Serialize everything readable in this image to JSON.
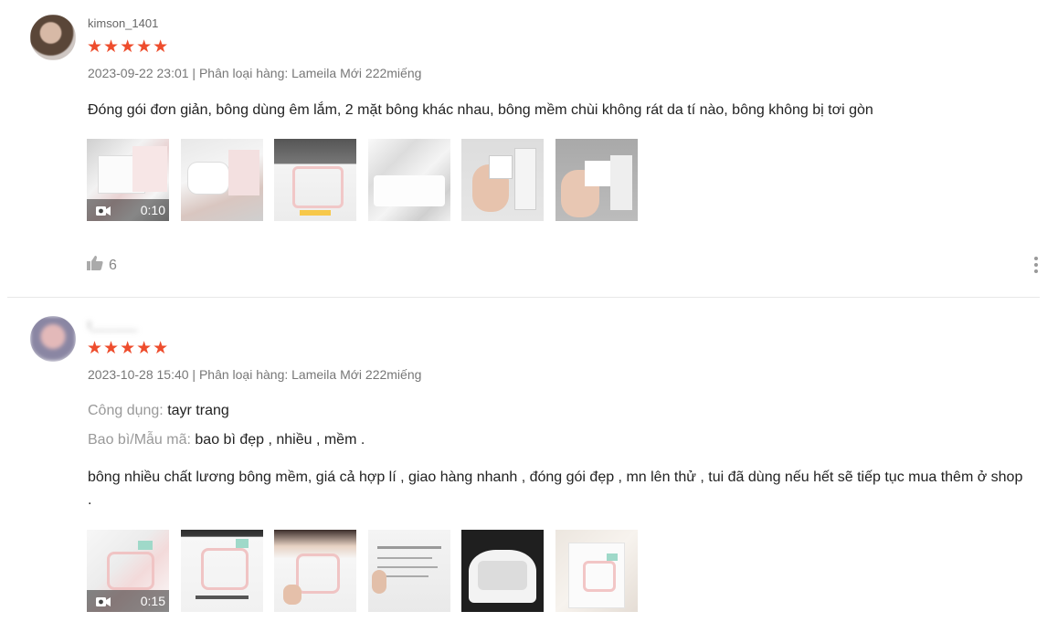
{
  "reviews": [
    {
      "username": "kimson_1401",
      "stars": "★★★★★",
      "meta": "2023-09-22 23:01 | Phân loại hàng: Lameila Mới 222miếng",
      "text": "Đóng gói đơn giản, bông dùng êm lắm, 2 mặt bông khác nhau, bông mềm chùi không rát da tí nào, bông không bị tơi gòn",
      "video_duration": "0:10",
      "likes": "6"
    },
    {
      "username": "t_______",
      "stars": "★★★★★",
      "meta": "2023-10-28 15:40 | Phân loại hàng: Lameila Mới 222miếng",
      "attributes": [
        {
          "label": "Công dụng:",
          "value": "tayr trang"
        },
        {
          "label": "Bao bì/Mẫu mã:",
          "value": "bao bì đẹp , nhiều , mềm ."
        }
      ],
      "text": "bông nhiều chất lương bông mềm, giá cả hợp lí , giao hàng nhanh , đóng gói đẹp , mn lên thử , tui đã dùng nếu hết sẽ tiếp tục mua thêm ở shop .",
      "video_duration": "0:15"
    }
  ],
  "colors": {
    "star": "#ee4d2d",
    "meta": "#777777",
    "label": "#999999"
  },
  "icons": [
    "thumbs-up-icon",
    "more-vertical-icon",
    "video-camera-icon"
  ]
}
